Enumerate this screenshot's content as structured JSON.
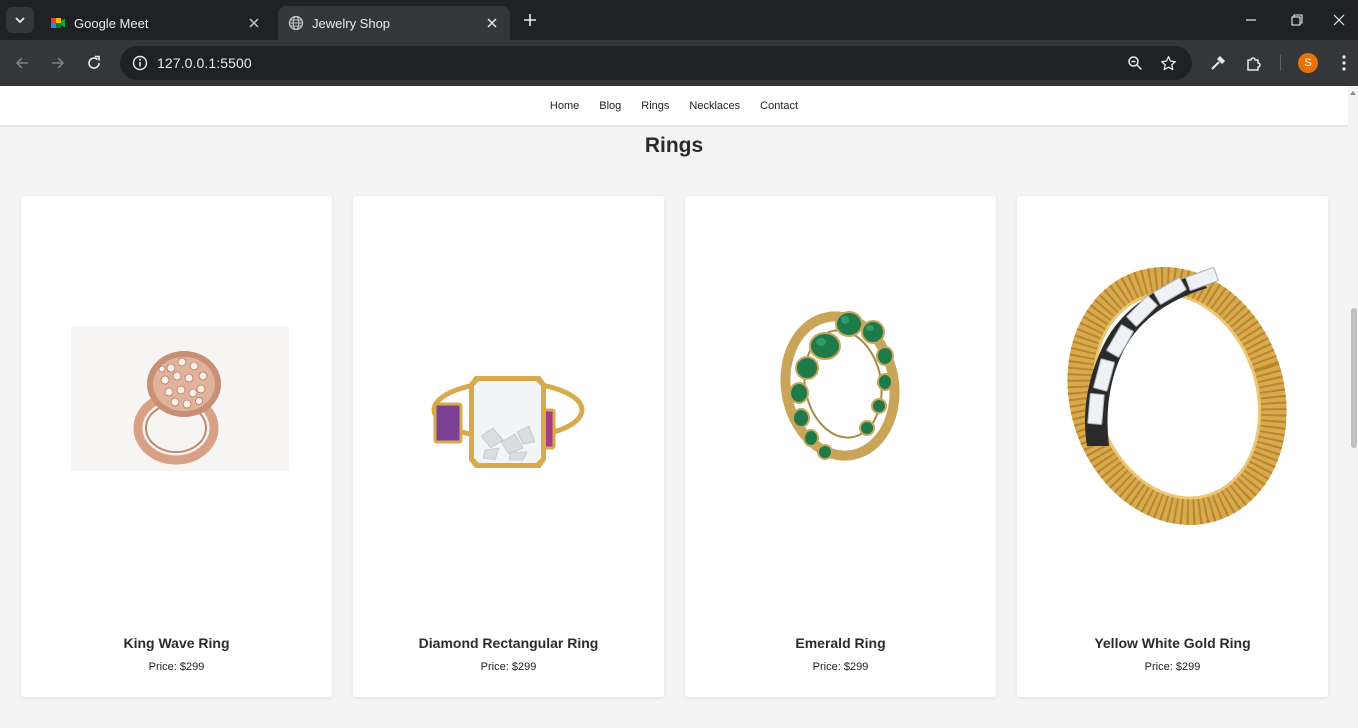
{
  "browser": {
    "tabs": [
      {
        "title": "Google Meet",
        "active": false,
        "favicon": "google-meet-icon"
      },
      {
        "title": "Jewelry Shop",
        "active": true,
        "favicon": "globe-icon"
      }
    ],
    "url": "127.0.0.1:5500",
    "profile_initial": "S",
    "profile_color": "#e8710a"
  },
  "site": {
    "nav": [
      "Home",
      "Blog",
      "Rings",
      "Necklaces",
      "Contact"
    ],
    "heading": "Rings"
  },
  "products": [
    {
      "name": "King Wave Ring",
      "price": "Price: $299",
      "image": "rose-gold-cluster-ring-image"
    },
    {
      "name": "Diamond Rectangular Ring",
      "price": "Price: $299",
      "image": "diamond-shaker-ring-image"
    },
    {
      "name": "Emerald Ring",
      "price": "Price: $299",
      "image": "emerald-eternity-ring-image"
    },
    {
      "name": "Yellow White Gold Ring",
      "price": "Price: $299",
      "image": "baguette-gold-band-ring-image"
    }
  ],
  "colors": {
    "chrome_dark": "#202124",
    "chrome_mid": "#35363a",
    "page_bg": "#f4f4f4",
    "gold": "#d9a94d",
    "rose_gold": "#d9a085",
    "emerald": "#1f7a4a"
  }
}
